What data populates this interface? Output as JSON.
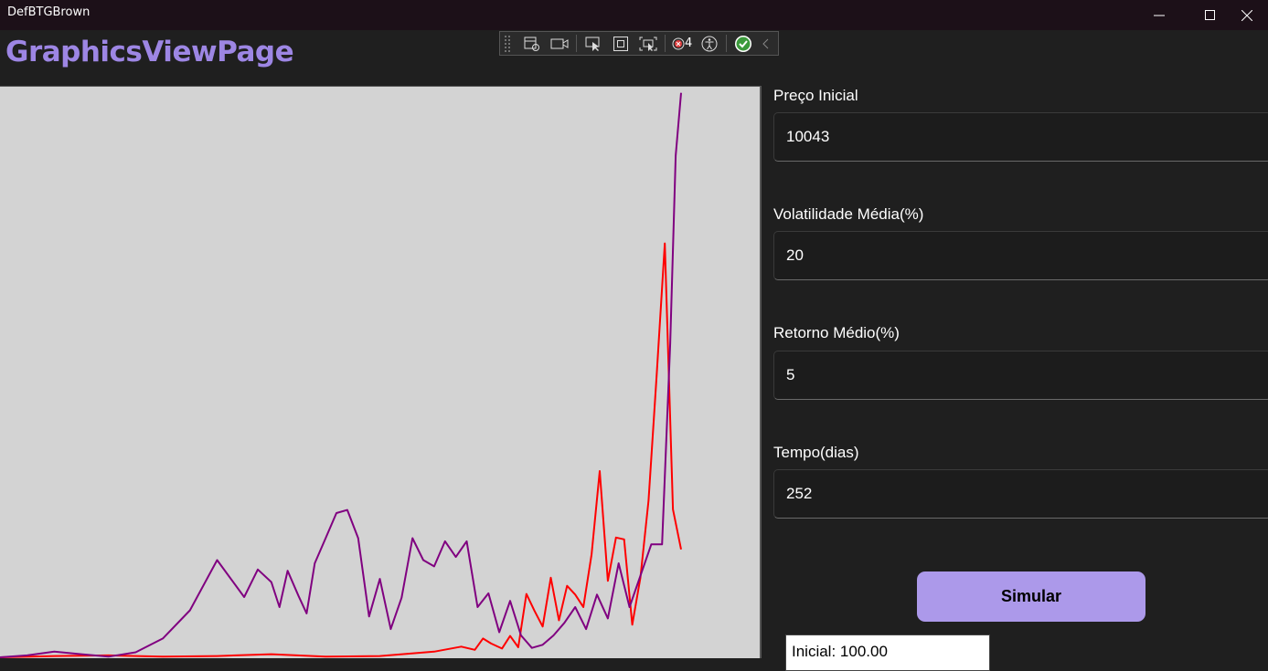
{
  "window": {
    "title": "DefBTGBrown"
  },
  "page": {
    "title": "GraphicsViewPage"
  },
  "toolbar": {
    "count": "4"
  },
  "form": {
    "fields": [
      {
        "label": "Preço Inicial",
        "value": "10043"
      },
      {
        "label": "Volatilidade Média(%)",
        "value": "20"
      },
      {
        "label": "Retorno Médio(%)",
        "value": "5"
      },
      {
        "label": "Tempo(dias)",
        "value": "252"
      }
    ],
    "simulate_label": "Simular",
    "result_text": "Inicial: 100.00"
  },
  "colors": {
    "accent": "#9d86e4",
    "button": "#ac99ea",
    "series_red": "#ff0000",
    "series_purple": "#800080",
    "graph_bg": "#d3d3d3"
  },
  "chart_data": {
    "type": "line",
    "title": "",
    "xlabel": "",
    "ylabel": "",
    "grid": false,
    "series": [
      {
        "color": "#ff0000",
        "x": [
          0,
          20,
          40,
          60,
          80,
          100,
          120,
          140,
          160,
          170,
          175,
          178,
          181,
          185,
          188,
          191,
          194,
          197,
          200,
          203,
          206,
          209,
          212,
          215,
          218,
          221,
          224,
          227,
          230,
          233,
          236,
          239,
          242,
          245,
          248,
          251
        ],
        "y": [
          0.0,
          0.02,
          0.03,
          0.01,
          0.02,
          0.05,
          0.01,
          0.02,
          0.09,
          0.17,
          0.12,
          0.3,
          0.22,
          0.14,
          0.34,
          0.16,
          1.01,
          0.74,
          0.49,
          1.27,
          0.59,
          1.14,
          1.0,
          0.8,
          1.64,
          2.97,
          1.22,
          1.91,
          1.88,
          0.52,
          1.27,
          2.5,
          4.5,
          6.6,
          2.36,
          1.72
        ]
      },
      {
        "color": "#800080",
        "x": [
          0,
          10,
          20,
          30,
          40,
          50,
          60,
          70,
          80,
          90,
          95,
          100,
          103,
          106,
          110,
          113,
          116,
          120,
          124,
          128,
          132,
          136,
          140,
          144,
          148,
          152,
          156,
          160,
          164,
          168,
          172,
          176,
          180,
          184,
          188,
          192,
          196,
          200,
          204,
          208,
          212,
          216,
          220,
          224,
          228,
          232,
          236,
          240,
          244,
          247,
          249,
          251
        ],
        "y": [
          0.0,
          0.03,
          0.09,
          0.05,
          0.01,
          0.08,
          0.3,
          0.75,
          1.55,
          0.96,
          1.4,
          1.2,
          0.8,
          1.38,
          0.98,
          0.7,
          1.5,
          1.9,
          2.3,
          2.35,
          1.9,
          0.65,
          1.25,
          0.45,
          0.95,
          1.9,
          1.55,
          1.45,
          1.85,
          1.6,
          1.85,
          0.8,
          1.02,
          0.4,
          0.9,
          0.35,
          0.15,
          0.2,
          0.35,
          0.55,
          0.8,
          0.45,
          1.0,
          0.62,
          1.5,
          0.8,
          1.3,
          1.8,
          1.8,
          5.0,
          8.0,
          9.0
        ]
      }
    ]
  }
}
